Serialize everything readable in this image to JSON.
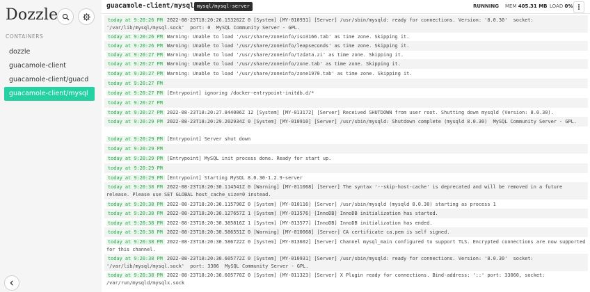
{
  "sidebar": {
    "brand": "Dozzle",
    "section_label": "CONTAINERS",
    "containers": [
      "dozzle",
      "guacamole-client",
      "guacamole-client/guacd",
      "guacamole-client/mysql"
    ],
    "active_index": 3,
    "search_icon": "search-icon",
    "settings_icon": "gear-icon",
    "collapse_icon": "chevron-left-icon"
  },
  "header": {
    "container_name": "guacamole-client/mysql",
    "container_tag": "mysql/mysql-server",
    "status": "RUNNING",
    "mem_label": "MEM",
    "mem_value": "405.31 MB",
    "load_label": "LOAD",
    "load_value": "0%",
    "menu_icon": "vertical-dots-icon"
  },
  "colors": {
    "accent": "#23d1a2",
    "timestamp_bg": "#e9f7ec",
    "timestamp_text": "#2e9e4d",
    "row_shade": "#f3f3f3"
  },
  "logs": [
    {
      "time": "today at 9:20:26 PM",
      "message": "2022-08-23T18:20:26.153262Z 0 [System] [MY-010931] [Server] /usr/sbin/mysqld: ready for connections. Version: '8.0.30'  socket: '/var/lib/mysql/mysql.sock'  port: 0  MySQL Community Server - GPL."
    },
    {
      "time": "today at 9:20:26 PM",
      "message": "Warning: Unable to load '/usr/share/zoneinfo/iso3166.tab' as time zone. Skipping it."
    },
    {
      "time": "today at 9:20:26 PM",
      "message": "Warning: Unable to load '/usr/share/zoneinfo/leapseconds' as time zone. Skipping it."
    },
    {
      "time": "today at 9:20:27 PM",
      "message": "Warning: Unable to load '/usr/share/zoneinfo/tzdata.zi' as time zone. Skipping it."
    },
    {
      "time": "today at 9:20:27 PM",
      "message": "Warning: Unable to load '/usr/share/zoneinfo/zone.tab' as time zone. Skipping it."
    },
    {
      "time": "today at 9:20:27 PM",
      "message": "Warning: Unable to load '/usr/share/zoneinfo/zone1970.tab' as time zone. Skipping it."
    },
    {
      "time": "today at 9:20:27 PM",
      "message": ""
    },
    {
      "time": "today at 9:20:27 PM",
      "message": "[Entrypoint] ignoring /docker-entrypoint-initdb.d/*"
    },
    {
      "time": "today at 9:20:27 PM",
      "message": ""
    },
    {
      "time": "today at 9:20:27 PM",
      "message": "2022-08-23T18:20:27.844006Z 12 [System] [MY-013172] [Server] Received SHUTDOWN from user root. Shutting down mysqld (Version: 8.0.30)."
    },
    {
      "time": "today at 9:20:29 PM",
      "message": "2022-08-23T18:20:29.202934Z 0 [System] [MY-010910] [Server] /usr/sbin/mysqld: Shutdown complete (mysqld 8.0.30)  MySQL Community Server - GPL."
    },
    {
      "time": "today at 9:20:29 PM",
      "message": "[Entrypoint] Server shut down"
    },
    {
      "time": "today at 9:20:29 PM",
      "message": ""
    },
    {
      "time": "today at 9:20:29 PM",
      "message": "[Entrypoint] MySQL init process done. Ready for start up."
    },
    {
      "time": "today at 9:20:29 PM",
      "message": ""
    },
    {
      "time": "today at 9:20:29 PM",
      "message": "[Entrypoint] Starting MySQL 8.0.30-1.2.9-server"
    },
    {
      "time": "today at 9:20:38 PM",
      "message": "2022-08-23T18:20:30.114541Z 0 [Warning] [MY-011068] [Server] The syntax '--skip-host-cache' is deprecated and will be removed in a future release. Please use SET GLOBAL host_cache_size=0 instead."
    },
    {
      "time": "today at 9:20:38 PM",
      "message": "2022-08-23T18:20:30.115790Z 0 [System] [MY-010116] [Server] /usr/sbin/mysqld (mysqld 8.0.30) starting as process 1"
    },
    {
      "time": "today at 9:20:38 PM",
      "message": "2022-08-23T18:20:30.127657Z 1 [System] [MY-013576] [InnoDB] InnoDB initialization has started."
    },
    {
      "time": "today at 9:20:38 PM",
      "message": "2022-08-23T18:20:30.385816Z 1 [System] [MY-013577] [InnoDB] InnoDB initialization has ended."
    },
    {
      "time": "today at 9:20:38 PM",
      "message": "2022-08-23T18:20:30.586551Z 0 [Warning] [MY-010068] [Server] CA certificate ca.pem is self signed."
    },
    {
      "time": "today at 9:20:38 PM",
      "message": "2022-08-23T18:20:30.586722Z 0 [System] [MY-013602] [Server] Channel mysql_main configured to support TLS. Encrypted connections are now supported for this channel."
    },
    {
      "time": "today at 9:20:38 PM",
      "message": "2022-08-23T18:20:30.605772Z 0 [System] [MY-010931] [Server] /usr/sbin/mysqld: ready for connections. Version: '8.0.30'  socket: '/var/lib/mysql/mysql.sock'  port: 3306  MySQL Community Server - GPL."
    },
    {
      "time": "today at 9:20:38 PM",
      "message": "2022-08-23T18:20:30.605770Z 0 [System] [MY-011323] [Server] X Plugin ready for connections. Bind-address: '::' port: 33060, socket: /var/run/mysqld/mysqlx.sock"
    }
  ]
}
